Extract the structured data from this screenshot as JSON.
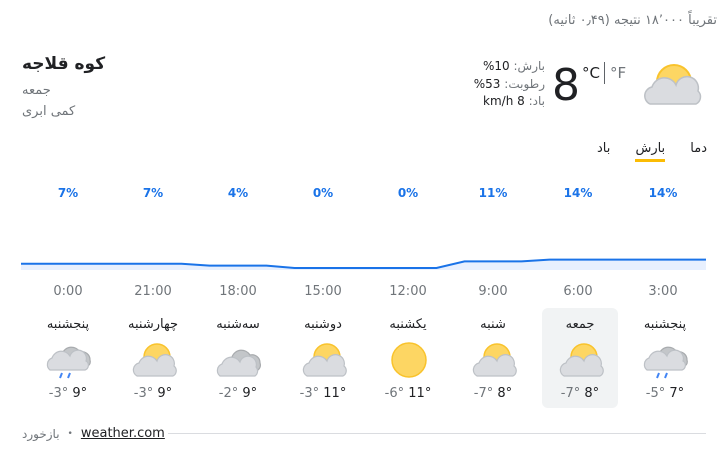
{
  "result_stats": "تقریباً ۱۸٬۰۰۰ نتیجه (۰٫۴۹ ثانیه)",
  "location": {
    "name": "کوه قلاجه",
    "day": "جمعه",
    "condition": "کمی ابری"
  },
  "current": {
    "temp": "8",
    "unit_c": "°C",
    "unit_f": "°F",
    "icon": "partly-cloudy-icon",
    "precip_label": "بارش:",
    "precip_value": "10%",
    "humidity_label": "رطوبت:",
    "humidity_value": "53%",
    "wind_label": "باد:",
    "wind_value": "8 km/h"
  },
  "tabs": [
    {
      "label": "دما",
      "active": false
    },
    {
      "label": "بارش",
      "active": true
    },
    {
      "label": "باد",
      "active": false
    }
  ],
  "chart_data": {
    "type": "area",
    "x": [
      "0:00",
      "21:00",
      "18:00",
      "15:00",
      "12:00",
      "9:00",
      "6:00",
      "3:00"
    ],
    "values": [
      7,
      7,
      4,
      0,
      0,
      11,
      14,
      14
    ],
    "labels": [
      "7%",
      "7%",
      "4%",
      "0%",
      "0%",
      "11%",
      "14%",
      "14%"
    ],
    "unit": "%",
    "color": "#1a73e8",
    "fill": "#e8f0fe"
  },
  "forecast": [
    {
      "day": "پنجشنبه",
      "hi": "9°",
      "lo": "-3°",
      "icon": "cloud-rain-icon",
      "selected": false
    },
    {
      "day": "چهارشنبه",
      "hi": "9°",
      "lo": "-3°",
      "icon": "partly-cloudy-icon",
      "selected": false
    },
    {
      "day": "سه‌شنبه",
      "hi": "9°",
      "lo": "-2°",
      "icon": "cloudy-icon",
      "selected": false
    },
    {
      "day": "دوشنبه",
      "hi": "11°",
      "lo": "-3°",
      "icon": "partly-cloudy-icon",
      "selected": false
    },
    {
      "day": "یکشنبه",
      "hi": "11°",
      "lo": "-6°",
      "icon": "sun-icon",
      "selected": false
    },
    {
      "day": "شنبه",
      "hi": "8°",
      "lo": "-7°",
      "icon": "partly-cloudy-icon",
      "selected": false
    },
    {
      "day": "جمعه",
      "hi": "8°",
      "lo": "-7°",
      "icon": "partly-cloudy-icon",
      "selected": true
    },
    {
      "day": "پنجشنبه",
      "hi": "7°",
      "lo": "-5°",
      "icon": "cloud-rain-icon",
      "selected": false
    }
  ],
  "footer": {
    "feedback": "بازخورد",
    "separator": "•",
    "source": "weather.com"
  }
}
